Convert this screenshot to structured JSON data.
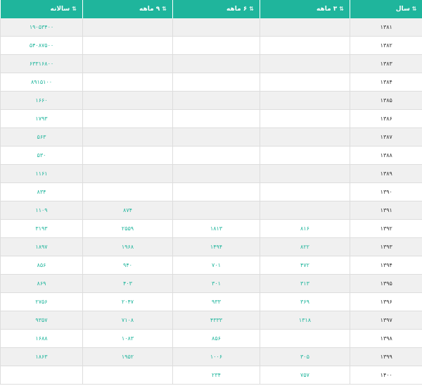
{
  "table": {
    "headers": {
      "year": "سال",
      "q3": "۳ ماهه",
      "h6": "۶ ماهه",
      "q9": "۹ ماهه",
      "annual": "سالانه",
      "sort_glyph": "⇅"
    },
    "rows": [
      {
        "year": "۱۳۸۱",
        "q3": "",
        "h6": "",
        "q9": "",
        "annual": "۱۹۰۵۳۴۰۰"
      },
      {
        "year": "۱۳۸۲",
        "q3": "",
        "h6": "",
        "q9": "",
        "annual": "۵۴۰۸۷۵۰۰"
      },
      {
        "year": "۱۳۸۳",
        "q3": "",
        "h6": "",
        "q9": "",
        "annual": "۶۳۳۱۶۸۰۰"
      },
      {
        "year": "۱۳۸۴",
        "q3": "",
        "h6": "",
        "q9": "",
        "annual": "۸۹۱۵۱۰۰"
      },
      {
        "year": "۱۳۸۵",
        "q3": "",
        "h6": "",
        "q9": "",
        "annual": "۱۶۶۰"
      },
      {
        "year": "۱۳۸۶",
        "q3": "",
        "h6": "",
        "q9": "",
        "annual": "۱۷۹۳"
      },
      {
        "year": "۱۳۸۷",
        "q3": "",
        "h6": "",
        "q9": "",
        "annual": "۵۶۳"
      },
      {
        "year": "۱۳۸۸",
        "q3": "",
        "h6": "",
        "q9": "",
        "annual": "۵۳۰"
      },
      {
        "year": "۱۳۸۹",
        "q3": "",
        "h6": "",
        "q9": "",
        "annual": "۱۱۶۱"
      },
      {
        "year": "۱۳۹۰",
        "q3": "",
        "h6": "",
        "q9": "",
        "annual": "۸۳۴"
      },
      {
        "year": "۱۳۹۱",
        "q3": "",
        "h6": "",
        "q9": "۸۷۴",
        "annual": "۱۱۰۹"
      },
      {
        "year": "۱۳۹۲",
        "q3": "۸۱۶",
        "h6": "۱۸۱۳",
        "q9": "۲۵۵۹",
        "annual": "۳۱۹۳"
      },
      {
        "year": "۱۳۹۳",
        "q3": "۸۲۲",
        "h6": "۱۴۹۴",
        "q9": "۱۹۶۸",
        "annual": "۱۸۹۷"
      },
      {
        "year": "۱۳۹۴",
        "q3": "۴۷۲",
        "h6": "۷۰۱",
        "q9": "۹۴۰",
        "annual": "۸۵۶"
      },
      {
        "year": "۱۳۹۵",
        "q3": "۳۱۳",
        "h6": "۳۰۱",
        "q9": "۴۰۳",
        "annual": "۸۶۹"
      },
      {
        "year": "۱۳۹۶",
        "q3": "۳۶۹",
        "h6": "۹۳۳",
        "q9": "۲۰۴۷",
        "annual": "۲۷۵۶"
      },
      {
        "year": "۱۳۹۷",
        "q3": "۱۳۱۸",
        "h6": "۴۳۳۳",
        "q9": "۷۱۰۸",
        "annual": "۹۳۵۷"
      },
      {
        "year": "۱۳۹۸",
        "q3": "",
        "h6": "۸۵۶",
        "q9": "۱۰۸۳",
        "annual": "۱۶۸۸"
      },
      {
        "year": "۱۳۹۹",
        "q3": "۳۰۵",
        "h6": "۱۰۰۶",
        "q9": "۱۹۵۲",
        "annual": "۱۸۶۳"
      },
      {
        "year": "۱۴۰۰",
        "q3": "۷۵۷",
        "h6": "۲۳۴",
        "q9": "",
        "annual": ""
      }
    ]
  }
}
